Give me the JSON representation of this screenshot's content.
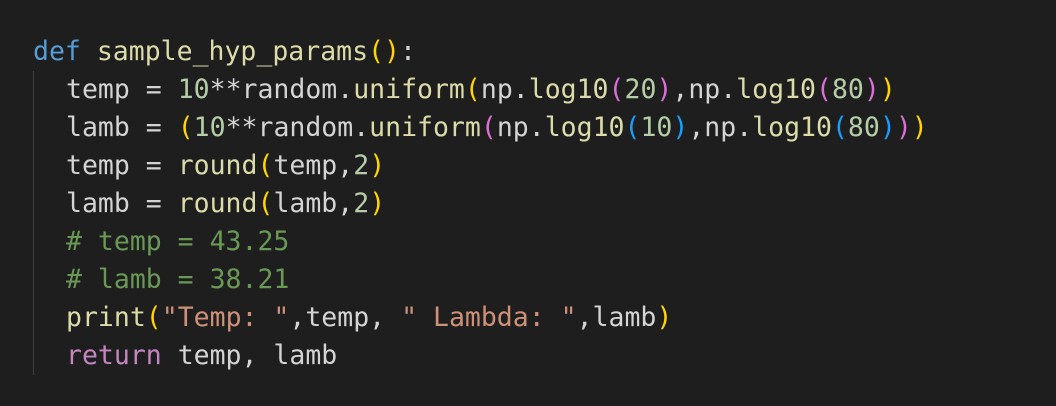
{
  "code_lines": [
    [
      {
        "text": "def",
        "kind": "kw"
      },
      {
        "text": " ",
        "kind": "txt"
      },
      {
        "text": "sample_hyp_params",
        "kind": "fn"
      },
      {
        "text": "(",
        "kind": "b1"
      },
      {
        "text": ")",
        "kind": "b1"
      },
      {
        "text": ":",
        "kind": "txt"
      }
    ],
    [
      {
        "text": "temp = ",
        "kind": "txt"
      },
      {
        "text": "10",
        "kind": "num"
      },
      {
        "text": "**random.",
        "kind": "txt"
      },
      {
        "text": "uniform",
        "kind": "fn"
      },
      {
        "text": "(",
        "kind": "b1"
      },
      {
        "text": "np.",
        "kind": "txt"
      },
      {
        "text": "log10",
        "kind": "fn"
      },
      {
        "text": "(",
        "kind": "b2"
      },
      {
        "text": "20",
        "kind": "num"
      },
      {
        "text": ")",
        "kind": "b2"
      },
      {
        "text": ",np.",
        "kind": "txt"
      },
      {
        "text": "log10",
        "kind": "fn"
      },
      {
        "text": "(",
        "kind": "b2"
      },
      {
        "text": "80",
        "kind": "num"
      },
      {
        "text": ")",
        "kind": "b2"
      },
      {
        "text": ")",
        "kind": "b1"
      }
    ],
    [
      {
        "text": "lamb = ",
        "kind": "txt"
      },
      {
        "text": "(",
        "kind": "b1"
      },
      {
        "text": "10",
        "kind": "num"
      },
      {
        "text": "**random.",
        "kind": "txt"
      },
      {
        "text": "uniform",
        "kind": "fn"
      },
      {
        "text": "(",
        "kind": "b2"
      },
      {
        "text": "np.",
        "kind": "txt"
      },
      {
        "text": "log10",
        "kind": "fn"
      },
      {
        "text": "(",
        "kind": "b3"
      },
      {
        "text": "10",
        "kind": "num"
      },
      {
        "text": ")",
        "kind": "b3"
      },
      {
        "text": ",np.",
        "kind": "txt"
      },
      {
        "text": "log10",
        "kind": "fn"
      },
      {
        "text": "(",
        "kind": "b3"
      },
      {
        "text": "80",
        "kind": "num"
      },
      {
        "text": ")",
        "kind": "b3"
      },
      {
        "text": ")",
        "kind": "b2"
      },
      {
        "text": ")",
        "kind": "b1"
      }
    ],
    [
      {
        "text": "temp = ",
        "kind": "txt"
      },
      {
        "text": "round",
        "kind": "fn"
      },
      {
        "text": "(",
        "kind": "b1"
      },
      {
        "text": "temp,",
        "kind": "txt"
      },
      {
        "text": "2",
        "kind": "num"
      },
      {
        "text": ")",
        "kind": "b1"
      }
    ],
    [
      {
        "text": "lamb = ",
        "kind": "txt"
      },
      {
        "text": "round",
        "kind": "fn"
      },
      {
        "text": "(",
        "kind": "b1"
      },
      {
        "text": "lamb,",
        "kind": "txt"
      },
      {
        "text": "2",
        "kind": "num"
      },
      {
        "text": ")",
        "kind": "b1"
      }
    ],
    [
      {
        "text": "# temp = 43.25",
        "kind": "com"
      }
    ],
    [
      {
        "text": "# lamb = 38.21",
        "kind": "com"
      }
    ],
    [
      {
        "text": "print",
        "kind": "fn"
      },
      {
        "text": "(",
        "kind": "b1"
      },
      {
        "text": "\"Temp: \"",
        "kind": "str"
      },
      {
        "text": ",temp, ",
        "kind": "txt"
      },
      {
        "text": "\" Lambda: \"",
        "kind": "str"
      },
      {
        "text": ",lamb",
        "kind": "txt"
      },
      {
        "text": ")",
        "kind": "b1"
      }
    ],
    [
      {
        "text": "return",
        "kind": "ctl"
      },
      {
        "text": " temp, lamb",
        "kind": "txt"
      }
    ]
  ]
}
